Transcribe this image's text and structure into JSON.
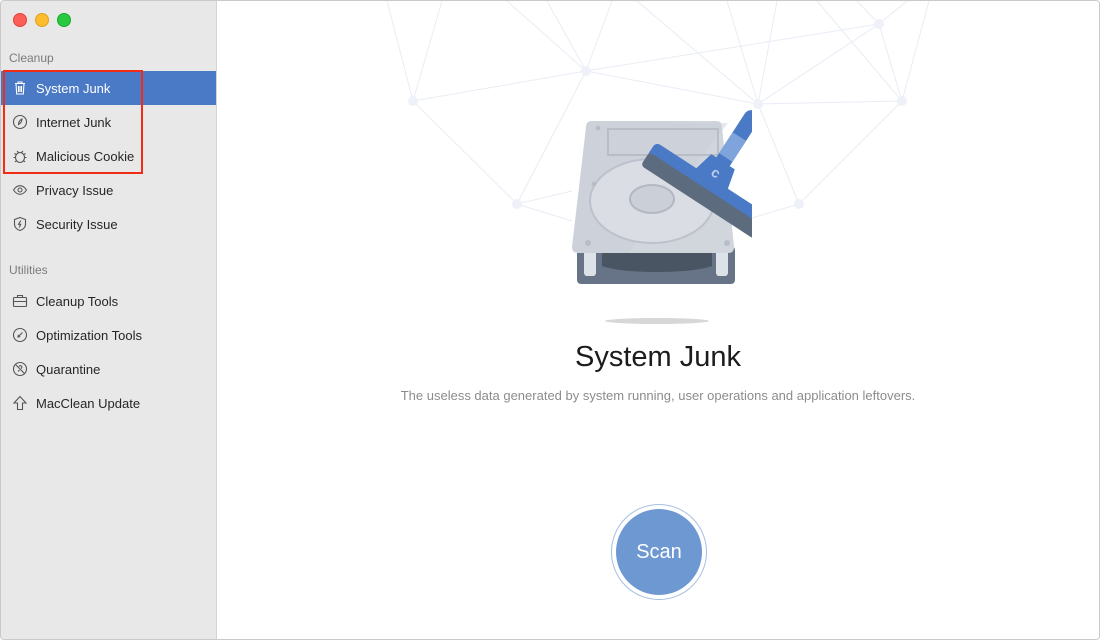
{
  "window": {
    "controls": [
      "close",
      "minimize",
      "maximize"
    ]
  },
  "sidebar": {
    "sections": [
      {
        "label": "Cleanup",
        "items": [
          {
            "label": "System Junk",
            "icon": "trash-icon",
            "active": true
          },
          {
            "label": "Internet Junk",
            "icon": "compass-leaf-icon",
            "active": false
          },
          {
            "label": "Malicious Cookie",
            "icon": "bug-icon",
            "active": false
          },
          {
            "label": "Privacy Issue",
            "icon": "eye-icon",
            "active": false
          },
          {
            "label": "Security Issue",
            "icon": "shield-bolt-icon",
            "active": false
          }
        ]
      },
      {
        "label": "Utilities",
        "items": [
          {
            "label": "Cleanup Tools",
            "icon": "toolbox-icon",
            "active": false
          },
          {
            "label": "Optimization Tools",
            "icon": "gauge-icon",
            "active": false
          },
          {
            "label": "Quarantine",
            "icon": "quarantine-icon",
            "active": false
          },
          {
            "label": "MacClean Update",
            "icon": "arrow-up-icon",
            "active": false
          }
        ]
      }
    ],
    "annotation_color": "#f12d18",
    "accent_color": "#4a7ac5"
  },
  "main": {
    "title": "System Junk",
    "description": "The useless data generated by system running, user operations and application leftovers.",
    "scan_label": "Scan",
    "illustration": "hard-drive-with-squeegee"
  }
}
